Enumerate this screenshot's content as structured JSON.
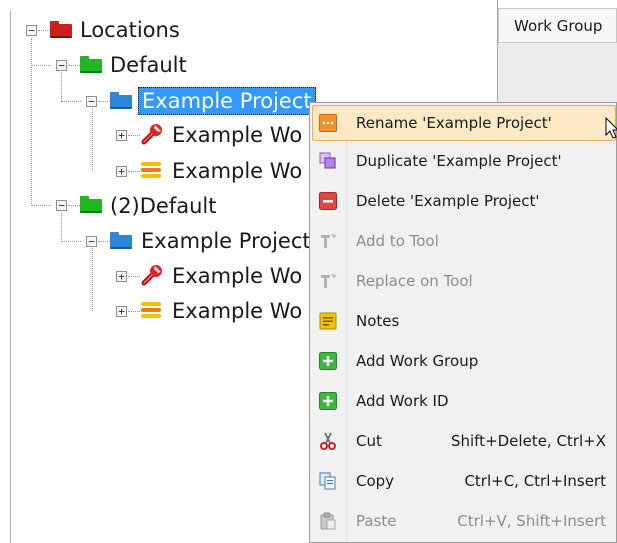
{
  "tree": {
    "nodes": [
      {
        "label": "Locations",
        "icon": "folder-red-icon",
        "expanded": true
      },
      {
        "label": "Default",
        "icon": "folder-green-icon",
        "expanded": true
      },
      {
        "label": "Example Project",
        "icon": "folder-blue-icon",
        "expanded": true,
        "selected": true
      },
      {
        "label": "Example Wo",
        "icon": "wrench-icon",
        "expanded": false
      },
      {
        "label": "Example Wo",
        "icon": "stack-icon",
        "expanded": false
      },
      {
        "label": "(2)Default",
        "icon": "folder-green-icon",
        "expanded": true
      },
      {
        "label": "Example Project",
        "icon": "folder-blue-icon",
        "expanded": true
      },
      {
        "label": "Example Wo",
        "icon": "wrench-icon",
        "expanded": false
      },
      {
        "label": "Example Wo",
        "icon": "stack-icon",
        "expanded": false
      }
    ]
  },
  "column": {
    "header": "Work Group"
  },
  "menu": {
    "items": [
      {
        "label": "Rename 'Example Project'",
        "icon": "rename-icon",
        "shortcut": "",
        "enabled": true,
        "highlighted": true
      },
      {
        "label": "Duplicate 'Example Project'",
        "icon": "duplicate-icon",
        "shortcut": "",
        "enabled": true
      },
      {
        "label": "Delete 'Example Project'",
        "icon": "delete-icon",
        "shortcut": "",
        "enabled": true
      },
      {
        "label": "Add to Tool",
        "icon": "tool-icon",
        "shortcut": "",
        "enabled": false
      },
      {
        "label": "Replace on Tool",
        "icon": "tool-icon",
        "shortcut": "",
        "enabled": false
      },
      {
        "label": "Notes",
        "icon": "notes-icon",
        "shortcut": "",
        "enabled": true
      },
      {
        "label": "Add Work Group",
        "icon": "add-icon",
        "shortcut": "",
        "enabled": true
      },
      {
        "label": "Add Work ID",
        "icon": "add-icon",
        "shortcut": "",
        "enabled": true
      },
      {
        "label": "Cut",
        "icon": "scissors-icon",
        "shortcut": "Shift+Delete, Ctrl+X",
        "enabled": true
      },
      {
        "label": "Copy",
        "icon": "copy-icon",
        "shortcut": "Ctrl+C, Ctrl+Insert",
        "enabled": true
      },
      {
        "label": "Paste",
        "icon": "paste-icon",
        "shortcut": "Ctrl+V, Shift+Insert",
        "enabled": false
      }
    ]
  },
  "colors": {
    "selection": "#3399ff",
    "menu_bg": "#f1f1f1",
    "menu_hover": "#fde9c6",
    "folder_red": "#cc1f1f",
    "folder_green": "#1fb81f",
    "folder_blue": "#2a86d8"
  }
}
